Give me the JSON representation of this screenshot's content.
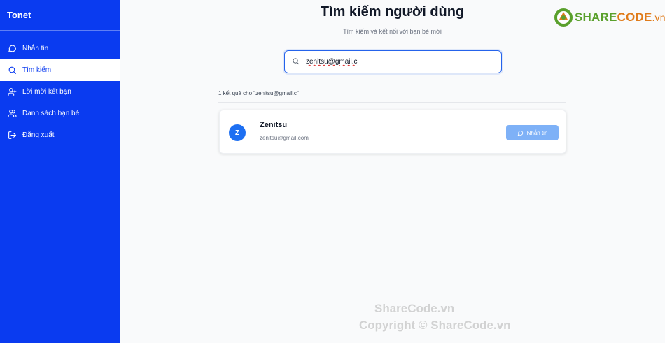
{
  "sidebar": {
    "brand": "Tonet",
    "items": [
      {
        "label": "Nhắn tin",
        "icon": "chat-icon"
      },
      {
        "label": "Tìm kiếm",
        "icon": "search-icon"
      },
      {
        "label": "Lời mời kết bạn",
        "icon": "user-plus-icon"
      },
      {
        "label": "Danh sách bạn bè",
        "icon": "users-icon"
      },
      {
        "label": "Đăng xuất",
        "icon": "logout-icon"
      }
    ]
  },
  "main": {
    "title": "Tìm kiếm người dùng",
    "subtitle": "Tìm kiếm và kết nối với bạn bè mới",
    "search": {
      "value": "zenitsu@gmail.c",
      "icon": "search-icon"
    },
    "result_count": "1 kết quả cho \"zenitsu@gmail.c\"",
    "results": [
      {
        "avatar": "Z",
        "name": "Zenitsu",
        "email": "zenitsu@gmail.com",
        "button": "Nhắn tin"
      }
    ]
  },
  "logo": {
    "share": "SHARE",
    "code": "CODE",
    "vn": ".vn"
  },
  "watermark": {
    "line1": "ShareCode.vn",
    "line2": "Copyright © ShareCode.vn"
  },
  "colors": {
    "sidebar": "#0a3bf0",
    "accent": "#2563eb",
    "button": "#7eb1f7",
    "avatar": "#1d6ff2"
  }
}
